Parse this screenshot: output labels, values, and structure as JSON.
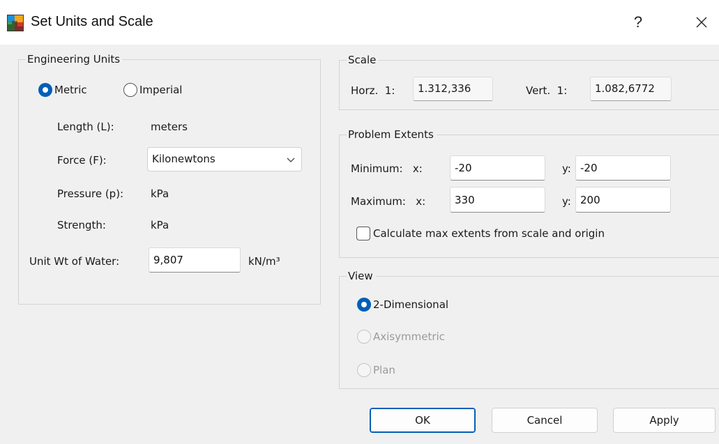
{
  "window": {
    "title": "Set Units and Scale",
    "help_label": "?",
    "icon": "rocscience-app-icon"
  },
  "engineering_units": {
    "legend": "Engineering Units",
    "system_options": [
      {
        "label": "Metric",
        "checked": true
      },
      {
        "label": "Imperial",
        "checked": false
      }
    ],
    "length_label": "Length (L):",
    "length_value": "meters",
    "force_label": "Force (F):",
    "force_selected": "Kilonewtons",
    "pressure_label": "Pressure (p):",
    "pressure_value": "kPa",
    "strength_label": "Strength:",
    "strength_value": "kPa",
    "unit_wt_label": "Unit Wt of Water:",
    "unit_wt_value": "9,807",
    "unit_wt_units": "kN/m³"
  },
  "scale": {
    "legend": "Scale",
    "horz_label": "Horz.  1:",
    "horz_value": "1.312,336",
    "vert_label": "Vert.  1:",
    "vert_value": "1.082,6772"
  },
  "problem_extents": {
    "legend": "Problem Extents",
    "minimum_label": "Minimum:   x:",
    "min_x": "-20",
    "min_y_label": "y:",
    "min_y": "-20",
    "maximum_label": "Maximum:   x:",
    "max_x": "330",
    "max_y_label": "y:",
    "max_y": "200",
    "calc_label": "Calculate max extents from scale and origin",
    "calc_checked": false
  },
  "view": {
    "legend": "View",
    "options": [
      {
        "label": "2-Dimensional",
        "checked": true,
        "enabled": true
      },
      {
        "label": "Axisymmetric",
        "checked": false,
        "enabled": false
      },
      {
        "label": "Plan",
        "checked": false,
        "enabled": false
      }
    ]
  },
  "buttons": {
    "ok": "OK",
    "cancel": "Cancel",
    "apply": "Apply"
  },
  "colors": {
    "accent": "#005fb8",
    "background": "#f0f0f0",
    "titlebar": "#ffffff"
  }
}
